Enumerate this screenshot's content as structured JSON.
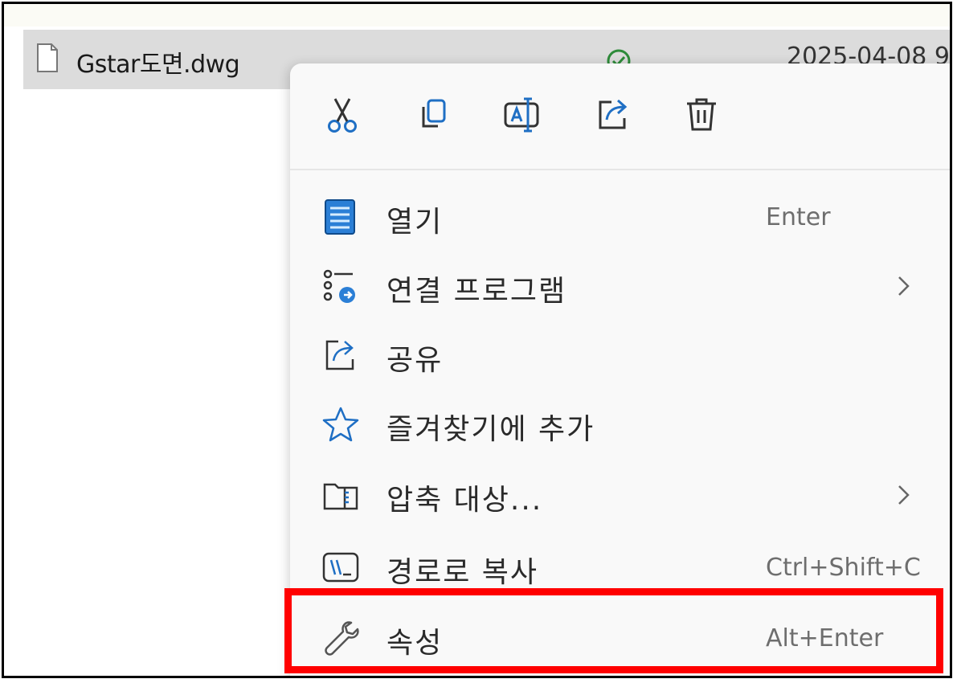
{
  "file": {
    "name": "Gstar도면.dwg",
    "date": "2025-04-08 9",
    "icon": "document-icon",
    "status_icon": "sync-ok-icon",
    "status_color": "#2e8b3a"
  },
  "toolbar": {
    "buttons": [
      {
        "icon": "cut-icon"
      },
      {
        "icon": "copy-icon"
      },
      {
        "icon": "rename-icon"
      },
      {
        "icon": "share-icon"
      },
      {
        "icon": "delete-icon"
      }
    ],
    "accent": "#1f6fc4"
  },
  "menu": {
    "items": [
      {
        "label": "열기",
        "shortcut": "Enter",
        "icon": "open-icon"
      },
      {
        "label": "연결 프로그램",
        "shortcut": "",
        "icon": "open-with-icon",
        "has_submenu": true
      },
      {
        "label": "공유",
        "shortcut": "",
        "icon": "share-icon"
      },
      {
        "label": "즐겨찾기에 추가",
        "shortcut": "",
        "icon": "star-icon"
      },
      {
        "label": "압축 대상...",
        "shortcut": "",
        "icon": "zip-folder-icon",
        "has_submenu": true
      },
      {
        "label": "경로로 복사",
        "shortcut": "Ctrl+Shift+C",
        "icon": "copy-path-icon"
      },
      {
        "label": "속성",
        "shortcut": "Alt+Enter",
        "icon": "wrench-icon"
      }
    ]
  },
  "annotation": {
    "highlight_color": "#ff0000"
  }
}
